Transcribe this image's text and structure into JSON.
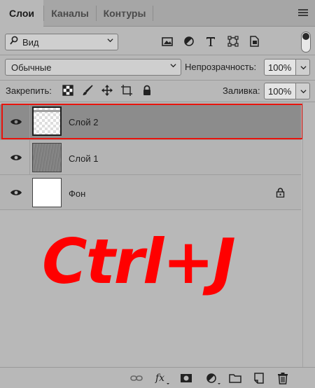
{
  "tabs": [
    {
      "label": "Слои",
      "active": true
    },
    {
      "label": "Каналы",
      "active": false
    },
    {
      "label": "Контуры",
      "active": false
    }
  ],
  "filter": {
    "kind_label": "Вид",
    "icons": [
      "image-filter-icon",
      "adjustment-filter-icon",
      "type-filter-icon",
      "shape-filter-icon",
      "smart-object-filter-icon"
    ]
  },
  "blend": {
    "mode": "Обычные",
    "opacity_label": "Непрозрачность:",
    "opacity_value": "100%"
  },
  "lock": {
    "label": "Закрепить:",
    "fill_label": "Заливка:",
    "fill_value": "100%",
    "icons": [
      "lock-transparent-pixels-icon",
      "lock-image-pixels-icon",
      "lock-position-icon",
      "lock-artboard-icon",
      "lock-all-icon"
    ]
  },
  "layers": [
    {
      "name": "Слой 2",
      "selected": true,
      "visible": true,
      "thumb": "transparent",
      "locked": false
    },
    {
      "name": "Слой 1",
      "selected": false,
      "visible": true,
      "thumb": "texture",
      "locked": false
    },
    {
      "name": "Фон",
      "selected": false,
      "visible": true,
      "thumb": "white",
      "locked": true
    }
  ],
  "overlay_text": "Ctrl+J",
  "accent_color": "#ff0000",
  "bottom_icons": [
    "link-layers-icon",
    "fx-icon",
    "layer-mask-icon",
    "adjustment-layer-icon",
    "group-folder-icon",
    "new-layer-icon",
    "trash-icon"
  ]
}
